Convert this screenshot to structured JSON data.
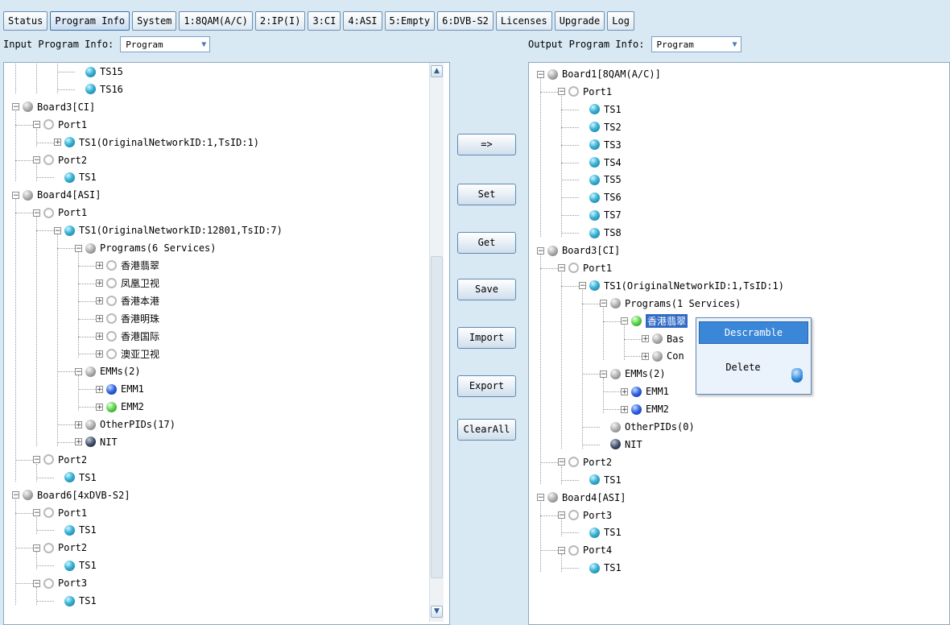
{
  "tabs": [
    {
      "label": "Status"
    },
    {
      "label": "Program Info",
      "active": true
    },
    {
      "label": "System"
    },
    {
      "label": "1:8QAM(A/C)"
    },
    {
      "label": "2:IP(I)"
    },
    {
      "label": "3:CI"
    },
    {
      "label": "4:ASI"
    },
    {
      "label": "5:Empty"
    },
    {
      "label": "6:DVB-S2"
    },
    {
      "label": "Licenses"
    },
    {
      "label": "Upgrade"
    },
    {
      "label": "Log"
    }
  ],
  "input": {
    "label": "Input Program Info:",
    "select_value": "Program",
    "tree": [
      {
        "level": 3,
        "icon": "teal",
        "text": "TS15"
      },
      {
        "level": 3,
        "icon": "teal",
        "text": "TS16"
      },
      {
        "level": 0,
        "exp": "-",
        "icon": "gray",
        "text": "Board3[CI]"
      },
      {
        "level": 1,
        "exp": "-",
        "icon": "ring",
        "text": "Port1"
      },
      {
        "level": 2,
        "exp": "+",
        "icon": "teal",
        "text": "TS1(OriginalNetworkID:1,TsID:1)"
      },
      {
        "level": 1,
        "exp": "-",
        "icon": "ring",
        "text": "Port2"
      },
      {
        "level": 2,
        "icon": "teal",
        "text": "TS1"
      },
      {
        "level": 0,
        "exp": "-",
        "icon": "gray",
        "text": "Board4[ASI]"
      },
      {
        "level": 1,
        "exp": "-",
        "icon": "ring",
        "text": "Port1"
      },
      {
        "level": 2,
        "exp": "-",
        "icon": "teal",
        "text": "TS1(OriginalNetworkID:12801,TsID:7)"
      },
      {
        "level": 3,
        "exp": "-",
        "icon": "gray",
        "text": "Programs(6 Services)"
      },
      {
        "level": 4,
        "exp": "+",
        "icon": "ring",
        "text": "香港翡翠"
      },
      {
        "level": 4,
        "exp": "+",
        "icon": "ring",
        "text": "凤凰卫视"
      },
      {
        "level": 4,
        "exp": "+",
        "icon": "ring",
        "text": "香港本港"
      },
      {
        "level": 4,
        "exp": "+",
        "icon": "ring",
        "text": "香港明珠"
      },
      {
        "level": 4,
        "exp": "+",
        "icon": "ring",
        "text": "香港国际"
      },
      {
        "level": 4,
        "exp": "+",
        "icon": "ring",
        "text": "澳亚卫视"
      },
      {
        "level": 3,
        "exp": "-",
        "icon": "gray",
        "text": "EMMs(2)"
      },
      {
        "level": 4,
        "exp": "+",
        "icon": "blue",
        "text": "EMM1"
      },
      {
        "level": 4,
        "exp": "+",
        "icon": "green",
        "text": "EMM2"
      },
      {
        "level": 3,
        "exp": "+",
        "icon": "gray",
        "text": "OtherPIDs(17)"
      },
      {
        "level": 3,
        "exp": "+",
        "icon": "dark",
        "text": "NIT"
      },
      {
        "level": 1,
        "exp": "-",
        "icon": "ring",
        "text": "Port2"
      },
      {
        "level": 2,
        "icon": "teal",
        "text": "TS1"
      },
      {
        "level": 0,
        "exp": "-",
        "icon": "gray",
        "text": "Board6[4xDVB-S2]"
      },
      {
        "level": 1,
        "exp": "-",
        "icon": "ring",
        "text": "Port1"
      },
      {
        "level": 2,
        "icon": "teal",
        "text": "TS1"
      },
      {
        "level": 1,
        "exp": "-",
        "icon": "ring",
        "text": "Port2"
      },
      {
        "level": 2,
        "icon": "teal",
        "text": "TS1"
      },
      {
        "level": 1,
        "exp": "-",
        "icon": "ring",
        "text": "Port3"
      },
      {
        "level": 2,
        "icon": "teal",
        "text": "TS1"
      }
    ]
  },
  "buttons": [
    "=>",
    "Set",
    "Get",
    "Save",
    "Import",
    "Export",
    "ClearAll"
  ],
  "output": {
    "label": "Output Program Info:",
    "select_value": "Program",
    "tree": [
      {
        "level": 0,
        "exp": "-",
        "icon": "gray",
        "text": "Board1[8QAM(A/C)]"
      },
      {
        "level": 1,
        "exp": "-",
        "icon": "ring",
        "text": "Port1"
      },
      {
        "level": 2,
        "icon": "teal",
        "text": "TS1"
      },
      {
        "level": 2,
        "icon": "teal",
        "text": "TS2"
      },
      {
        "level": 2,
        "icon": "teal",
        "text": "TS3"
      },
      {
        "level": 2,
        "icon": "teal",
        "text": "TS4"
      },
      {
        "level": 2,
        "icon": "teal",
        "text": "TS5"
      },
      {
        "level": 2,
        "icon": "teal",
        "text": "TS6"
      },
      {
        "level": 2,
        "icon": "teal",
        "text": "TS7"
      },
      {
        "level": 2,
        "icon": "teal",
        "text": "TS8"
      },
      {
        "level": 0,
        "exp": "-",
        "icon": "gray",
        "text": "Board3[CI]"
      },
      {
        "level": 1,
        "exp": "-",
        "icon": "ring",
        "text": "Port1"
      },
      {
        "level": 2,
        "exp": "-",
        "icon": "teal",
        "text": "TS1(OriginalNetworkID:1,TsID:1)"
      },
      {
        "level": 3,
        "exp": "-",
        "icon": "gray",
        "text": "Programs(1 Services)"
      },
      {
        "level": 4,
        "exp": "-",
        "icon": "green",
        "text": "香港翡翠",
        "selected": true
      },
      {
        "level": 5,
        "exp": "+",
        "icon": "gray",
        "text": "Bas"
      },
      {
        "level": 5,
        "exp": "+",
        "icon": "gray",
        "text": "Con"
      },
      {
        "level": 3,
        "exp": "-",
        "icon": "gray",
        "text": "EMMs(2)"
      },
      {
        "level": 4,
        "exp": "+",
        "icon": "blue",
        "text": "EMM1"
      },
      {
        "level": 4,
        "exp": "+",
        "icon": "blue",
        "text": "EMM2"
      },
      {
        "level": 3,
        "icon": "gray",
        "text": "OtherPIDs(0)"
      },
      {
        "level": 3,
        "icon": "dark",
        "text": "NIT"
      },
      {
        "level": 1,
        "exp": "-",
        "icon": "ring",
        "text": "Port2"
      },
      {
        "level": 2,
        "icon": "teal",
        "text": "TS1"
      },
      {
        "level": 0,
        "exp": "-",
        "icon": "gray",
        "text": "Board4[ASI]"
      },
      {
        "level": 1,
        "exp": "-",
        "icon": "ring",
        "text": "Port3"
      },
      {
        "level": 2,
        "icon": "teal",
        "text": "TS1"
      },
      {
        "level": 1,
        "exp": "-",
        "icon": "ring",
        "text": "Port4"
      },
      {
        "level": 2,
        "icon": "teal",
        "text": "TS1"
      }
    ]
  },
  "context_menu": {
    "descramble": "Descramble",
    "delete": "Delete"
  }
}
